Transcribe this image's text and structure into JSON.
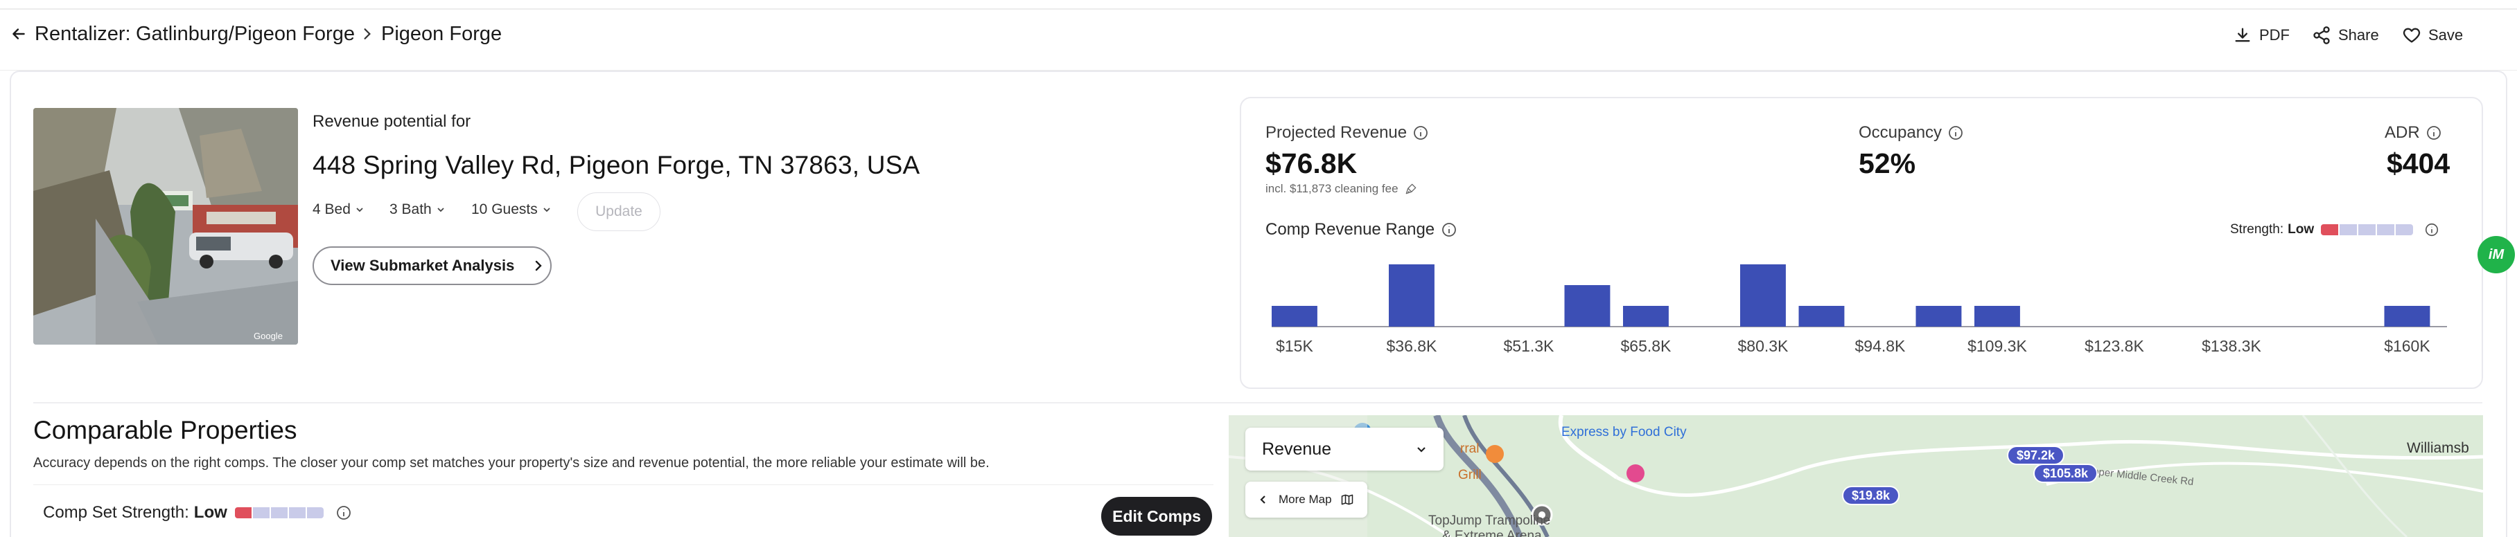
{
  "header": {
    "breadcrumb_root": "Rentalizer:",
    "breadcrumb_market": "Gatlinburg/Pigeon Forge",
    "breadcrumb_submarket": "Pigeon Forge",
    "actions": {
      "pdf": "PDF",
      "share": "Share",
      "save": "Save"
    }
  },
  "property": {
    "revenue_potential_for": "Revenue potential for",
    "address": "448 Spring Valley Rd, Pigeon Forge, TN 37863, USA",
    "bedrooms": "4 Bed",
    "bathrooms": "3 Bath",
    "guests": "10 Guests",
    "update_label": "Update",
    "submarket_button": "View Submarket Analysis",
    "photo_watermark": "Google"
  },
  "metrics": {
    "projected_revenue_label": "Projected Revenue",
    "projected_revenue_value": "$76.8K",
    "cleaning_note": "incl. $11,873 cleaning fee",
    "occupancy_label": "Occupancy",
    "occupancy_value": "52%",
    "adr_label": "ADR",
    "adr_value": "$404"
  },
  "comp_range": {
    "label": "Comp Revenue Range",
    "strength_label": "Strength:",
    "strength_value": "Low"
  },
  "chart_data": {
    "type": "bar",
    "title": "Comp Revenue Range",
    "xlabel": "",
    "ylabel": "",
    "categories": [
      "$15K",
      "",
      "$36.8K",
      "",
      "$51.3K",
      "",
      "$65.8K",
      "",
      "$80.3K",
      "",
      "$94.8K",
      "",
      "$109.3K",
      "",
      "$123.8K",
      "",
      "$138.3K",
      "",
      "",
      "$160K"
    ],
    "values": [
      1,
      0,
      3,
      0,
      0,
      2,
      1,
      0,
      3,
      1,
      0,
      1,
      1,
      0,
      0,
      0,
      0,
      0,
      0,
      1
    ],
    "tick_labels": [
      "$15K",
      "$36.8K",
      "$51.3K",
      "$65.8K",
      "$80.3K",
      "$94.8K",
      "$109.3K",
      "$123.8K",
      "$138.3K",
      "$160K"
    ],
    "ylim": [
      0,
      3
    ],
    "grid": false,
    "color": "#3c4fb5"
  },
  "comparable": {
    "title": "Comparable Properties",
    "description": "Accuracy depends on the right comps. The closer your comp set matches your property's size and revenue potential, the more reliable your estimate will be.",
    "strength_label": "Comp Set Strength:",
    "strength_value": "Low",
    "edit_button": "Edit Comps"
  },
  "map": {
    "metric_select": "Revenue",
    "more_map": "More Map",
    "labels": {
      "express": "Express by Food City",
      "topjump_1": "TopJump Trampoline",
      "topjump_2": "& Extreme Arena",
      "grill_1": "rral",
      "grill_2": "Grill",
      "williamsburg": "Williamsb",
      "creek": "Upper Middle Creek Rd"
    },
    "pins": [
      "$97.2k",
      "$105.8k",
      "$19.8k"
    ]
  },
  "float_badge": "iM",
  "colors": {
    "accent": "#3c4fb5",
    "strength_low": "#e04f5c",
    "strength_empty": "#c9cbe9",
    "dark_button": "#1f1f22"
  }
}
